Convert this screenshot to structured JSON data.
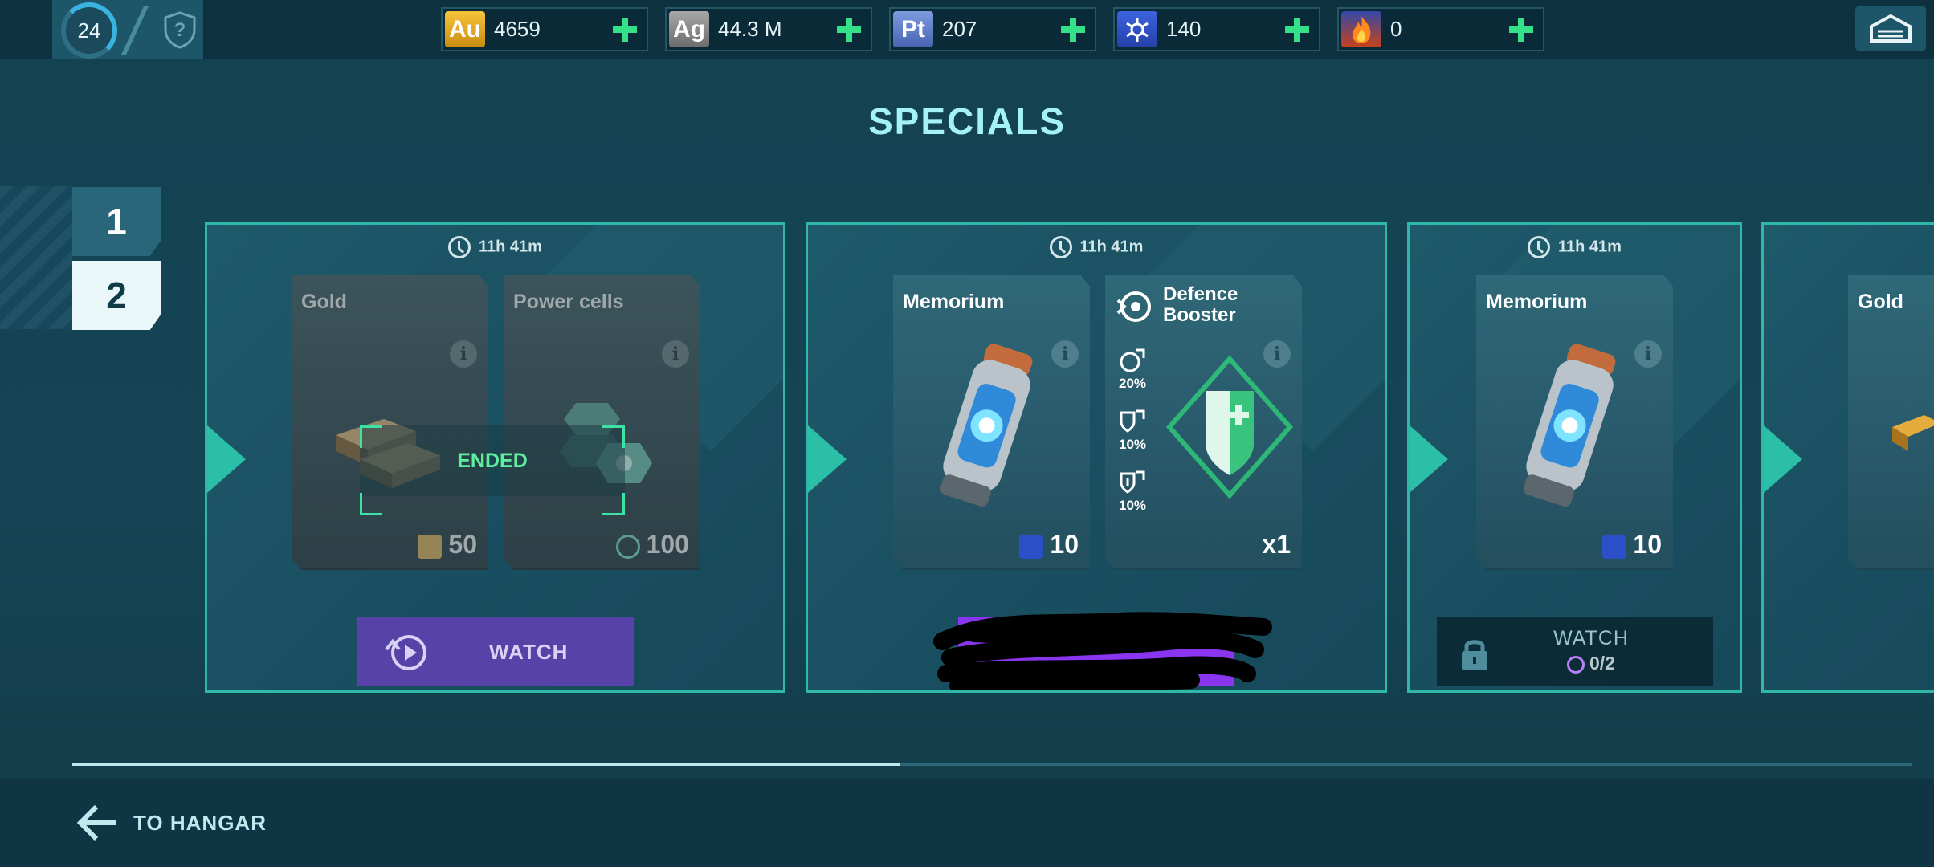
{
  "topbar": {
    "level": "24",
    "resources": [
      {
        "code": "Au",
        "value": "4659",
        "color": "#d9a21a"
      },
      {
        "code": "Ag",
        "value": "44.3 M",
        "color": "#8a8a8a"
      },
      {
        "code": "Pt",
        "value": "207",
        "color": "#5d7ec9"
      },
      {
        "code": "",
        "value": "140",
        "color": "#2b4fc7"
      },
      {
        "code": "",
        "value": "0",
        "color": "#e0561f"
      }
    ]
  },
  "title": "SPECIALS",
  "tabs": [
    "1",
    "2"
  ],
  "offers": [
    {
      "timer": "11h 41m",
      "items": [
        {
          "name": "Gold",
          "amount": "50"
        },
        {
          "name": "Power cells",
          "amount": "100"
        }
      ],
      "status": "ENDED",
      "button": "WATCH"
    },
    {
      "timer": "11h 41m",
      "items": [
        {
          "name": "Memorium",
          "amount": "10"
        },
        {
          "name": "Defence Booster",
          "amount": "x1",
          "stats": [
            "20%",
            "10%",
            "10%"
          ]
        }
      ]
    },
    {
      "timer": "11h 41m",
      "items": [
        {
          "name": "Memorium",
          "amount": "10"
        }
      ],
      "button_line1": "WATCH",
      "button_line2": "0/2"
    },
    {
      "items": [
        {
          "name": "Gold"
        }
      ]
    }
  ],
  "progress": 0.45,
  "footer": {
    "back_label": "TO HANGAR"
  }
}
